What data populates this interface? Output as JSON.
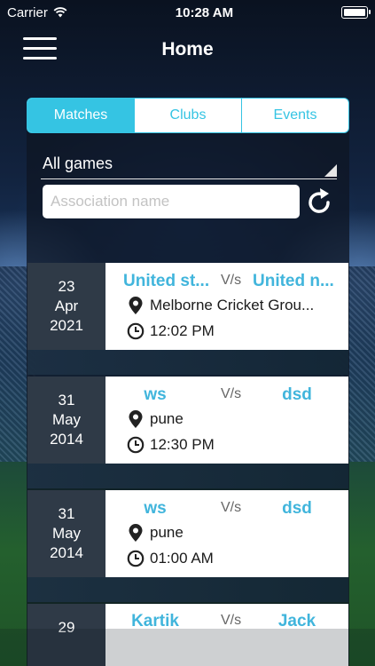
{
  "status_bar": {
    "carrier": "Carrier",
    "time": "10:28 AM"
  },
  "nav": {
    "title": "Home"
  },
  "tabs": [
    {
      "label": "Matches",
      "active": true
    },
    {
      "label": "Clubs",
      "active": false
    },
    {
      "label": "Events",
      "active": false
    }
  ],
  "filter": {
    "selected": "All games"
  },
  "search": {
    "value": "",
    "placeholder": "Association name"
  },
  "matches": [
    {
      "day": "23",
      "month": "Apr",
      "year": "2021",
      "team_a": "United st...",
      "vs": "V/s",
      "team_b": "United n...",
      "location": "Melborne Cricket Grou...",
      "time": "12:02 PM"
    },
    {
      "day": "31",
      "month": "May",
      "year": "2014",
      "team_a": "ws",
      "vs": "V/s",
      "team_b": "dsd",
      "location": "pune",
      "time": "12:30 PM"
    },
    {
      "day": "31",
      "month": "May",
      "year": "2014",
      "team_a": "ws",
      "vs": "V/s",
      "team_b": "dsd",
      "location": "pune",
      "time": "01:00 AM"
    },
    {
      "day": "29",
      "month": "",
      "year": "",
      "team_a": "Kartik",
      "vs": "V/s",
      "team_b": "Jack",
      "location": "",
      "time": ""
    }
  ],
  "colors": {
    "accent": "#35c4e3",
    "team_text": "#41b5dc",
    "date_box": "#2f3a47"
  },
  "icons": {
    "menu": "hamburger-icon",
    "refresh": "refresh-icon",
    "location": "map-pin-icon",
    "time": "clock-icon"
  }
}
